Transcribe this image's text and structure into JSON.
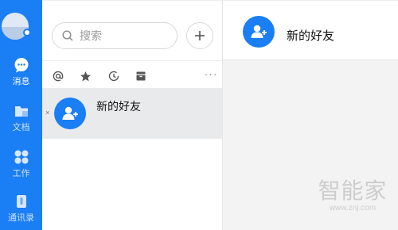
{
  "nav": {
    "items": [
      {
        "key": "messages",
        "label": "消息",
        "icon": "chat-bubble-icon",
        "active": true
      },
      {
        "key": "docs",
        "label": "文档",
        "icon": "folder-icon",
        "active": false
      },
      {
        "key": "work",
        "label": "工作",
        "icon": "grid-icon",
        "active": false
      },
      {
        "key": "contacts",
        "label": "通讯录",
        "icon": "contacts-icon",
        "active": false
      }
    ]
  },
  "search": {
    "placeholder": "搜索"
  },
  "filters": [
    {
      "icon": "at-icon"
    },
    {
      "icon": "star-icon"
    },
    {
      "icon": "clock-icon"
    },
    {
      "icon": "archive-icon"
    }
  ],
  "more_label": "···",
  "sessions": [
    {
      "name": "新的好友",
      "close": "×",
      "icon": "add-friend-icon"
    }
  ],
  "chat": {
    "title": "新的好友",
    "icon": "add-friend-icon"
  },
  "watermark": {
    "title": "智能家",
    "url": "www.znj.com"
  },
  "colors": {
    "accent": "#1a7ef5",
    "selected_row": "#e9eaec"
  }
}
